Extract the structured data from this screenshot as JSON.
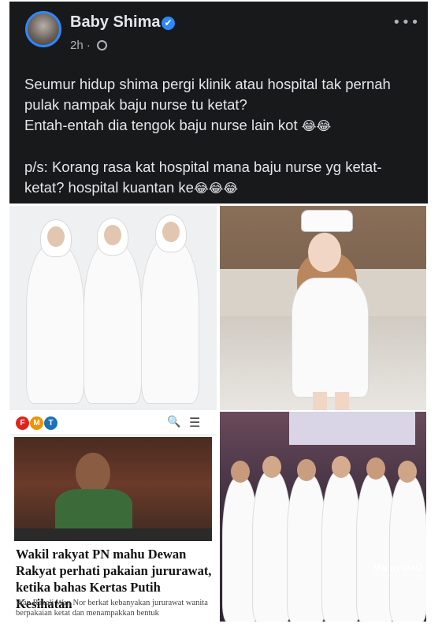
{
  "post": {
    "author": "Baby Shima",
    "time": "2h",
    "separator": "·",
    "verified_glyph": "✔",
    "more_glyph": "•••",
    "body": "Seumur hidup shima pergi klinik atau hospital tak pernah pulak nampak  baju nurse tu ketat?\nEntah-entah dia tengok baju nurse lain kot",
    "body2": "p/s: Korang rasa kat hospital mana baju nurse yg ketat-ketat? hospital kuantan ke",
    "emoji1": "😂😂",
    "emoji2": "😂😂😂"
  },
  "news": {
    "logo_letters": [
      "F",
      "M",
      "T"
    ],
    "logo_colors": [
      "#e2231a",
      "#f39200",
      "#1d71b8"
    ],
    "search_glyph": "🔍",
    "menu_glyph": "☰",
    "headline": "Wakil rakyat PN mahu Dewan Rakyat perhati pakaian jururawat, ketika bahas Kertas Putih Kesihatan",
    "subtext": "Wan Razali Wan Nor berkat kebanyakan jururawat wanita berpakaian ketat dan menampakkan bentuk"
  },
  "photo4": {
    "watermark": "MalaysiaG",
    "watermark_sub": "INDORE2A HARIAN"
  },
  "icons": [
    "verified-badge-icon",
    "globe-icon",
    "more-options-icon",
    "search-icon",
    "menu-icon"
  ]
}
